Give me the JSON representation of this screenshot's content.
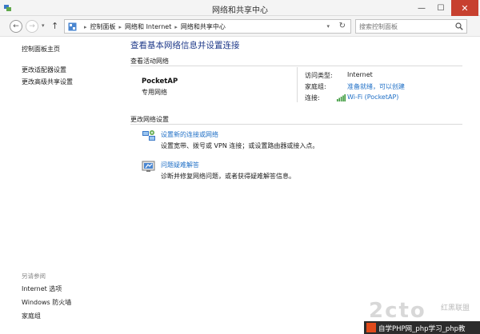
{
  "window": {
    "title": "网络和共享中心",
    "minimize": "—",
    "maximize": "☐",
    "close": "✕"
  },
  "address": {
    "breadcrumbs": [
      "控制面板",
      "网络和 Internet",
      "网络和共享中心"
    ],
    "search_placeholder": "搜索控制面板"
  },
  "sidebar": {
    "home": "控制面板主页",
    "links": [
      "更改适配器设置",
      "更改高级共享设置"
    ],
    "see_also_heading": "另请参阅",
    "see_also": [
      "Internet 选项",
      "Windows 防火墙",
      "家庭组"
    ]
  },
  "main": {
    "title": "查看基本网络信息并设置连接",
    "active_heading": "查看活动网络",
    "network_name": "PocketAP",
    "network_type": "专用网络",
    "access_type_label": "访问类型:",
    "access_type_value": "Internet",
    "homegroup_label": "家庭组:",
    "homegroup_value": "准备就绪，可以创建",
    "connection_label": "连接:",
    "connection_value": "Wi-Fi (PocketAP)",
    "change_heading": "更改网络设置",
    "tasks": [
      {
        "link": "设置新的连接或网络",
        "desc": "设置宽带、拨号或 VPN 连接；或设置路由器或接入点。",
        "icon": "network-setup-icon"
      },
      {
        "link": "问题疑难解答",
        "desc": "诊断并修复网络问题，或者获得疑难解答信息。",
        "icon": "troubleshoot-icon"
      }
    ]
  },
  "watermark": {
    "logo": "2cto",
    "cn": "红黑联盟",
    "strip": "自学PHP网_php学习_php教"
  },
  "colors": {
    "link": "#1f6fc6",
    "title": "#1f3a8a",
    "close": "#c7402f"
  }
}
